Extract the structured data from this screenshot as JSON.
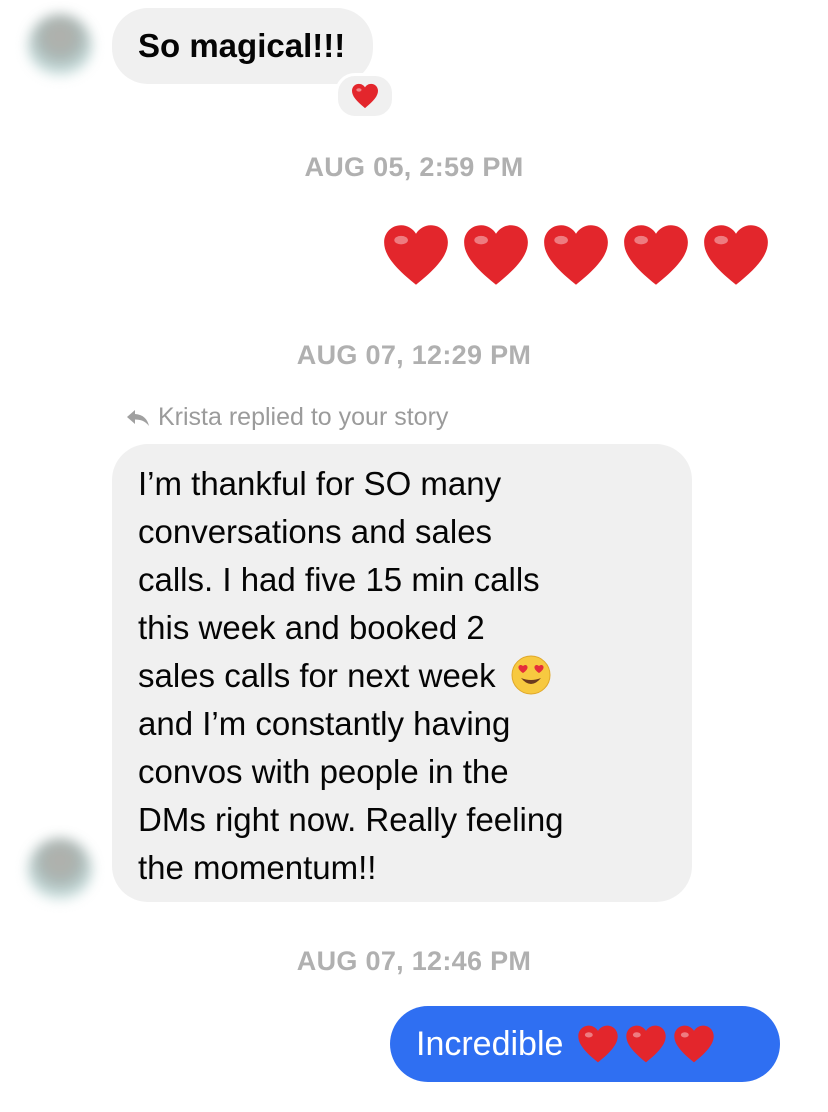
{
  "messages": {
    "msg1": {
      "text": "So magical!!!",
      "reaction": "heart-icon"
    },
    "timestamp1": "AUG 05, 2:59 PM",
    "msg2": {
      "emoji": "five red hearts"
    },
    "timestamp2": "AUG 07, 12:29 PM",
    "reply_context": "Krista replied to your story",
    "msg3": {
      "line1": "I’m thankful for SO many",
      "line2": "conversations and sales",
      "line3": "calls. I had five 15 min calls",
      "line4": "this week and booked 2",
      "line5": "sales calls for next week",
      "line6": "and I’m constantly having",
      "line7": "convos with people in the",
      "line8": "DMs right now. Really feeling",
      "line9": "the momentum!!"
    },
    "timestamp3": "AUG 07, 12:46 PM",
    "msg4": {
      "text": "Incredible"
    }
  },
  "colors": {
    "incoming_bubble": "#f0f0f0",
    "outgoing_bubble": "#2f6ff2",
    "timestamp_text": "#b0b0b0",
    "heart_red": "#e3262c"
  }
}
